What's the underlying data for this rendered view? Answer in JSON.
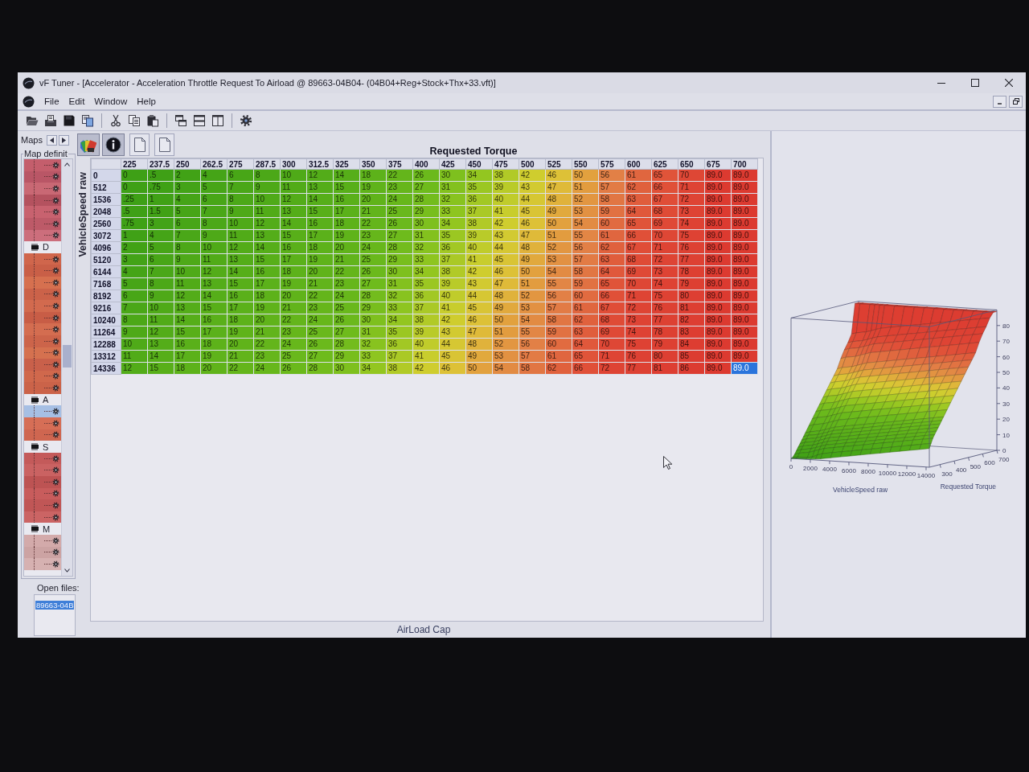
{
  "window": {
    "title": "vF Tuner  - [Accelerator - Acceleration Throttle Request To Airload @ 89663-04B04- (04B04+Reg+Stock+Thx+33.vft)]"
  },
  "menu": [
    "File",
    "Edit",
    "Window",
    "Help"
  ],
  "toolbar": [
    {
      "kind": "open"
    },
    {
      "kind": "import"
    },
    {
      "kind": "save"
    },
    {
      "kind": "compare"
    },
    {
      "kind": "separator"
    },
    {
      "kind": "cut"
    },
    {
      "kind": "copy"
    },
    {
      "kind": "paste"
    },
    {
      "kind": "separator"
    },
    {
      "kind": "cascade"
    },
    {
      "kind": "tile_horizontal"
    },
    {
      "kind": "tile_vertical"
    },
    {
      "kind": "separator"
    },
    {
      "kind": "settings"
    }
  ],
  "sidebar": {
    "tab_label": "Maps",
    "group_label": "Map definit",
    "map_tree": [
      {
        "children": [
          {
            "color": "#c45e6c",
            "selected": false
          },
          {
            "color": "#b95666",
            "selected": false
          },
          {
            "color": "#c96874",
            "selected": false
          },
          {
            "color": "#b4525f",
            "selected": false
          },
          {
            "color": "#c8626f",
            "selected": false
          },
          {
            "color": "#bd5a68",
            "selected": false
          },
          {
            "color": "#cc6e7c",
            "selected": false
          }
        ]
      },
      {
        "label": "D",
        "children": [
          {
            "color": "#d0664c",
            "selected": false
          },
          {
            "color": "#c95f47",
            "selected": false
          },
          {
            "color": "#d6704f",
            "selected": false
          },
          {
            "color": "#cb6249",
            "selected": false
          },
          {
            "color": "#d26a4e",
            "selected": false
          },
          {
            "color": "#c85d46",
            "selected": false
          },
          {
            "color": "#d46d50",
            "selected": false
          },
          {
            "color": "#cc644a",
            "selected": false
          },
          {
            "color": "#d5714f",
            "selected": false
          },
          {
            "color": "#c9604a",
            "selected": false
          },
          {
            "color": "#d0684c",
            "selected": false
          },
          {
            "color": "#cb6349",
            "selected": false
          }
        ]
      },
      {
        "label": "A",
        "children": [
          {
            "selected": true
          },
          {
            "color": "#d66e56",
            "selected": false
          },
          {
            "color": "#cf6650",
            "selected": false
          }
        ]
      },
      {
        "label": "S",
        "children": [
          {
            "color": "#c45a5a",
            "selected": false
          },
          {
            "color": "#ca6262",
            "selected": false
          },
          {
            "color": "#bd5353",
            "selected": false
          },
          {
            "color": "#c85c5c",
            "selected": false
          },
          {
            "color": "#c05656",
            "selected": false
          },
          {
            "color": "#cb6464",
            "selected": false
          }
        ]
      },
      {
        "label": "M",
        "children": [
          {
            "color": "#d3aaaa",
            "selected": false
          },
          {
            "color": "#cca3a3",
            "selected": false
          },
          {
            "color": "#d6b1b1",
            "selected": false
          }
        ]
      }
    ],
    "open_files_label": "Open files:",
    "open_files": [
      {
        "label": "89663-04B",
        "selected": true
      }
    ]
  },
  "map_view": {
    "title": "Requested Torque",
    "row_axis_label": "VehicleSpeed raw",
    "footer_label": "AirLoad Cap",
    "view_buttons": [
      {
        "kind": "palette",
        "pressed": true
      },
      {
        "kind": "info",
        "pressed": true
      },
      {
        "kind": "page",
        "pressed": false
      },
      {
        "kind": "page",
        "pressed": false
      }
    ]
  },
  "table": {
    "columns": [
      "225",
      "237.5",
      "250",
      "262.5",
      "275",
      "287.5",
      "300",
      "312.5",
      "325",
      "350",
      "375",
      "400",
      "425",
      "450",
      "475",
      "500",
      "525",
      "550",
      "575",
      "600",
      "625",
      "650",
      "675",
      "700"
    ],
    "rows": [
      {
        "label": "0",
        "cells": [
          {
            "value": "0",
            "selected": false
          },
          {
            "value": ".5",
            "selected": false
          },
          {
            "value": "2",
            "selected": false
          },
          {
            "value": "4",
            "selected": false
          },
          {
            "value": "6",
            "selected": false
          },
          {
            "value": "8",
            "selected": false
          },
          {
            "value": "10",
            "selected": false
          },
          {
            "value": "12",
            "selected": false
          },
          {
            "value": "14",
            "selected": false
          },
          {
            "value": "18",
            "selected": false
          },
          {
            "value": "22",
            "selected": false
          },
          {
            "value": "26",
            "selected": false
          },
          {
            "value": "30",
            "selected": false
          },
          {
            "value": "34",
            "selected": false
          },
          {
            "value": "38",
            "selected": false
          },
          {
            "value": "42",
            "selected": false
          },
          {
            "value": "46",
            "selected": false
          },
          {
            "value": "50",
            "selected": false
          },
          {
            "value": "56",
            "selected": false
          },
          {
            "value": "61",
            "selected": false
          },
          {
            "value": "65",
            "selected": false
          },
          {
            "value": "70",
            "selected": false
          },
          {
            "value": "89.0",
            "selected": false
          },
          {
            "value": "89.0",
            "selected": false
          }
        ]
      },
      {
        "label": "512",
        "cells": [
          {
            "value": "0",
            "selected": false
          },
          {
            "value": ".75",
            "selected": false
          },
          {
            "value": "3",
            "selected": false
          },
          {
            "value": "5",
            "selected": false
          },
          {
            "value": "7",
            "selected": false
          },
          {
            "value": "9",
            "selected": false
          },
          {
            "value": "11",
            "selected": false
          },
          {
            "value": "13",
            "selected": false
          },
          {
            "value": "15",
            "selected": false
          },
          {
            "value": "19",
            "selected": false
          },
          {
            "value": "23",
            "selected": false
          },
          {
            "value": "27",
            "selected": false
          },
          {
            "value": "31",
            "selected": false
          },
          {
            "value": "35",
            "selected": false
          },
          {
            "value": "39",
            "selected": false
          },
          {
            "value": "43",
            "selected": false
          },
          {
            "value": "47",
            "selected": false
          },
          {
            "value": "51",
            "selected": false
          },
          {
            "value": "57",
            "selected": false
          },
          {
            "value": "62",
            "selected": false
          },
          {
            "value": "66",
            "selected": false
          },
          {
            "value": "71",
            "selected": false
          },
          {
            "value": "89.0",
            "selected": false
          },
          {
            "value": "89.0",
            "selected": false
          }
        ]
      },
      {
        "label": "1536",
        "cells": [
          {
            "value": ".25",
            "selected": false
          },
          {
            "value": "1",
            "selected": false
          },
          {
            "value": "4",
            "selected": false
          },
          {
            "value": "6",
            "selected": false
          },
          {
            "value": "8",
            "selected": false
          },
          {
            "value": "10",
            "selected": false
          },
          {
            "value": "12",
            "selected": false
          },
          {
            "value": "14",
            "selected": false
          },
          {
            "value": "16",
            "selected": false
          },
          {
            "value": "20",
            "selected": false
          },
          {
            "value": "24",
            "selected": false
          },
          {
            "value": "28",
            "selected": false
          },
          {
            "value": "32",
            "selected": false
          },
          {
            "value": "36",
            "selected": false
          },
          {
            "value": "40",
            "selected": false
          },
          {
            "value": "44",
            "selected": false
          },
          {
            "value": "48",
            "selected": false
          },
          {
            "value": "52",
            "selected": false
          },
          {
            "value": "58",
            "selected": false
          },
          {
            "value": "63",
            "selected": false
          },
          {
            "value": "67",
            "selected": false
          },
          {
            "value": "72",
            "selected": false
          },
          {
            "value": "89.0",
            "selected": false
          },
          {
            "value": "89.0",
            "selected": false
          }
        ]
      },
      {
        "label": "2048",
        "cells": [
          {
            "value": ".5",
            "selected": false
          },
          {
            "value": "1.5",
            "selected": false
          },
          {
            "value": "5",
            "selected": false
          },
          {
            "value": "7",
            "selected": false
          },
          {
            "value": "9",
            "selected": false
          },
          {
            "value": "11",
            "selected": false
          },
          {
            "value": "13",
            "selected": false
          },
          {
            "value": "15",
            "selected": false
          },
          {
            "value": "17",
            "selected": false
          },
          {
            "value": "21",
            "selected": false
          },
          {
            "value": "25",
            "selected": false
          },
          {
            "value": "29",
            "selected": false
          },
          {
            "value": "33",
            "selected": false
          },
          {
            "value": "37",
            "selected": false
          },
          {
            "value": "41",
            "selected": false
          },
          {
            "value": "45",
            "selected": false
          },
          {
            "value": "49",
            "selected": false
          },
          {
            "value": "53",
            "selected": false
          },
          {
            "value": "59",
            "selected": false
          },
          {
            "value": "64",
            "selected": false
          },
          {
            "value": "68",
            "selected": false
          },
          {
            "value": "73",
            "selected": false
          },
          {
            "value": "89.0",
            "selected": false
          },
          {
            "value": "89.0",
            "selected": false
          }
        ]
      },
      {
        "label": "2560",
        "cells": [
          {
            "value": ".75",
            "selected": false
          },
          {
            "value": "3",
            "selected": false
          },
          {
            "value": "6",
            "selected": false
          },
          {
            "value": "8",
            "selected": false
          },
          {
            "value": "10",
            "selected": false
          },
          {
            "value": "12",
            "selected": false
          },
          {
            "value": "14",
            "selected": false
          },
          {
            "value": "16",
            "selected": false
          },
          {
            "value": "18",
            "selected": false
          },
          {
            "value": "22",
            "selected": false
          },
          {
            "value": "26",
            "selected": false
          },
          {
            "value": "30",
            "selected": false
          },
          {
            "value": "34",
            "selected": false
          },
          {
            "value": "38",
            "selected": false
          },
          {
            "value": "42",
            "selected": false
          },
          {
            "value": "46",
            "selected": false
          },
          {
            "value": "50",
            "selected": false
          },
          {
            "value": "54",
            "selected": false
          },
          {
            "value": "60",
            "selected": false
          },
          {
            "value": "65",
            "selected": false
          },
          {
            "value": "69",
            "selected": false
          },
          {
            "value": "74",
            "selected": false
          },
          {
            "value": "89.0",
            "selected": false
          },
          {
            "value": "89.0",
            "selected": false
          }
        ]
      },
      {
        "label": "3072",
        "cells": [
          {
            "value": "1",
            "selected": false
          },
          {
            "value": "4",
            "selected": false
          },
          {
            "value": "7",
            "selected": false
          },
          {
            "value": "9",
            "selected": false
          },
          {
            "value": "11",
            "selected": false
          },
          {
            "value": "13",
            "selected": false
          },
          {
            "value": "15",
            "selected": false
          },
          {
            "value": "17",
            "selected": false
          },
          {
            "value": "19",
            "selected": false
          },
          {
            "value": "23",
            "selected": false
          },
          {
            "value": "27",
            "selected": false
          },
          {
            "value": "31",
            "selected": false
          },
          {
            "value": "35",
            "selected": false
          },
          {
            "value": "39",
            "selected": false
          },
          {
            "value": "43",
            "selected": false
          },
          {
            "value": "47",
            "selected": false
          },
          {
            "value": "51",
            "selected": false
          },
          {
            "value": "55",
            "selected": false
          },
          {
            "value": "61",
            "selected": false
          },
          {
            "value": "66",
            "selected": false
          },
          {
            "value": "70",
            "selected": false
          },
          {
            "value": "75",
            "selected": false
          },
          {
            "value": "89.0",
            "selected": false
          },
          {
            "value": "89.0",
            "selected": false
          }
        ]
      },
      {
        "label": "4096",
        "cells": [
          {
            "value": "2",
            "selected": false
          },
          {
            "value": "5",
            "selected": false
          },
          {
            "value": "8",
            "selected": false
          },
          {
            "value": "10",
            "selected": false
          },
          {
            "value": "12",
            "selected": false
          },
          {
            "value": "14",
            "selected": false
          },
          {
            "value": "16",
            "selected": false
          },
          {
            "value": "18",
            "selected": false
          },
          {
            "value": "20",
            "selected": false
          },
          {
            "value": "24",
            "selected": false
          },
          {
            "value": "28",
            "selected": false
          },
          {
            "value": "32",
            "selected": false
          },
          {
            "value": "36",
            "selected": false
          },
          {
            "value": "40",
            "selected": false
          },
          {
            "value": "44",
            "selected": false
          },
          {
            "value": "48",
            "selected": false
          },
          {
            "value": "52",
            "selected": false
          },
          {
            "value": "56",
            "selected": false
          },
          {
            "value": "62",
            "selected": false
          },
          {
            "value": "67",
            "selected": false
          },
          {
            "value": "71",
            "selected": false
          },
          {
            "value": "76",
            "selected": false
          },
          {
            "value": "89.0",
            "selected": false
          },
          {
            "value": "89.0",
            "selected": false
          }
        ]
      },
      {
        "label": "5120",
        "cells": [
          {
            "value": "3",
            "selected": false
          },
          {
            "value": "6",
            "selected": false
          },
          {
            "value": "9",
            "selected": false
          },
          {
            "value": "11",
            "selected": false
          },
          {
            "value": "13",
            "selected": false
          },
          {
            "value": "15",
            "selected": false
          },
          {
            "value": "17",
            "selected": false
          },
          {
            "value": "19",
            "selected": false
          },
          {
            "value": "21",
            "selected": false
          },
          {
            "value": "25",
            "selected": false
          },
          {
            "value": "29",
            "selected": false
          },
          {
            "value": "33",
            "selected": false
          },
          {
            "value": "37",
            "selected": false
          },
          {
            "value": "41",
            "selected": false
          },
          {
            "value": "45",
            "selected": false
          },
          {
            "value": "49",
            "selected": false
          },
          {
            "value": "53",
            "selected": false
          },
          {
            "value": "57",
            "selected": false
          },
          {
            "value": "63",
            "selected": false
          },
          {
            "value": "68",
            "selected": false
          },
          {
            "value": "72",
            "selected": false
          },
          {
            "value": "77",
            "selected": false
          },
          {
            "value": "89.0",
            "selected": false
          },
          {
            "value": "89.0",
            "selected": false
          }
        ]
      },
      {
        "label": "6144",
        "cells": [
          {
            "value": "4",
            "selected": false
          },
          {
            "value": "7",
            "selected": false
          },
          {
            "value": "10",
            "selected": false
          },
          {
            "value": "12",
            "selected": false
          },
          {
            "value": "14",
            "selected": false
          },
          {
            "value": "16",
            "selected": false
          },
          {
            "value": "18",
            "selected": false
          },
          {
            "value": "20",
            "selected": false
          },
          {
            "value": "22",
            "selected": false
          },
          {
            "value": "26",
            "selected": false
          },
          {
            "value": "30",
            "selected": false
          },
          {
            "value": "34",
            "selected": false
          },
          {
            "value": "38",
            "selected": false
          },
          {
            "value": "42",
            "selected": false
          },
          {
            "value": "46",
            "selected": false
          },
          {
            "value": "50",
            "selected": false
          },
          {
            "value": "54",
            "selected": false
          },
          {
            "value": "58",
            "selected": false
          },
          {
            "value": "64",
            "selected": false
          },
          {
            "value": "69",
            "selected": false
          },
          {
            "value": "73",
            "selected": false
          },
          {
            "value": "78",
            "selected": false
          },
          {
            "value": "89.0",
            "selected": false
          },
          {
            "value": "89.0",
            "selected": false
          }
        ]
      },
      {
        "label": "7168",
        "cells": [
          {
            "value": "5",
            "selected": false
          },
          {
            "value": "8",
            "selected": false
          },
          {
            "value": "11",
            "selected": false
          },
          {
            "value": "13",
            "selected": false
          },
          {
            "value": "15",
            "selected": false
          },
          {
            "value": "17",
            "selected": false
          },
          {
            "value": "19",
            "selected": false
          },
          {
            "value": "21",
            "selected": false
          },
          {
            "value": "23",
            "selected": false
          },
          {
            "value": "27",
            "selected": false
          },
          {
            "value": "31",
            "selected": false
          },
          {
            "value": "35",
            "selected": false
          },
          {
            "value": "39",
            "selected": false
          },
          {
            "value": "43",
            "selected": false
          },
          {
            "value": "47",
            "selected": false
          },
          {
            "value": "51",
            "selected": false
          },
          {
            "value": "55",
            "selected": false
          },
          {
            "value": "59",
            "selected": false
          },
          {
            "value": "65",
            "selected": false
          },
          {
            "value": "70",
            "selected": false
          },
          {
            "value": "74",
            "selected": false
          },
          {
            "value": "79",
            "selected": false
          },
          {
            "value": "89.0",
            "selected": false
          },
          {
            "value": "89.0",
            "selected": false
          }
        ]
      },
      {
        "label": "8192",
        "cells": [
          {
            "value": "6",
            "selected": false
          },
          {
            "value": "9",
            "selected": false
          },
          {
            "value": "12",
            "selected": false
          },
          {
            "value": "14",
            "selected": false
          },
          {
            "value": "16",
            "selected": false
          },
          {
            "value": "18",
            "selected": false
          },
          {
            "value": "20",
            "selected": false
          },
          {
            "value": "22",
            "selected": false
          },
          {
            "value": "24",
            "selected": false
          },
          {
            "value": "28",
            "selected": false
          },
          {
            "value": "32",
            "selected": false
          },
          {
            "value": "36",
            "selected": false
          },
          {
            "value": "40",
            "selected": false
          },
          {
            "value": "44",
            "selected": false
          },
          {
            "value": "48",
            "selected": false
          },
          {
            "value": "52",
            "selected": false
          },
          {
            "value": "56",
            "selected": false
          },
          {
            "value": "60",
            "selected": false
          },
          {
            "value": "66",
            "selected": false
          },
          {
            "value": "71",
            "selected": false
          },
          {
            "value": "75",
            "selected": false
          },
          {
            "value": "80",
            "selected": false
          },
          {
            "value": "89.0",
            "selected": false
          },
          {
            "value": "89.0",
            "selected": false
          }
        ]
      },
      {
        "label": "9216",
        "cells": [
          {
            "value": "7",
            "selected": false
          },
          {
            "value": "10",
            "selected": false
          },
          {
            "value": "13",
            "selected": false
          },
          {
            "value": "15",
            "selected": false
          },
          {
            "value": "17",
            "selected": false
          },
          {
            "value": "19",
            "selected": false
          },
          {
            "value": "21",
            "selected": false
          },
          {
            "value": "23",
            "selected": false
          },
          {
            "value": "25",
            "selected": false
          },
          {
            "value": "29",
            "selected": false
          },
          {
            "value": "33",
            "selected": false
          },
          {
            "value": "37",
            "selected": false
          },
          {
            "value": "41",
            "selected": false
          },
          {
            "value": "45",
            "selected": false
          },
          {
            "value": "49",
            "selected": false
          },
          {
            "value": "53",
            "selected": false
          },
          {
            "value": "57",
            "selected": false
          },
          {
            "value": "61",
            "selected": false
          },
          {
            "value": "67",
            "selected": false
          },
          {
            "value": "72",
            "selected": false
          },
          {
            "value": "76",
            "selected": false
          },
          {
            "value": "81",
            "selected": false
          },
          {
            "value": "89.0",
            "selected": false
          },
          {
            "value": "89.0",
            "selected": false
          }
        ]
      },
      {
        "label": "10240",
        "cells": [
          {
            "value": "8",
            "selected": false
          },
          {
            "value": "11",
            "selected": false
          },
          {
            "value": "14",
            "selected": false
          },
          {
            "value": "16",
            "selected": false
          },
          {
            "value": "18",
            "selected": false
          },
          {
            "value": "20",
            "selected": false
          },
          {
            "value": "22",
            "selected": false
          },
          {
            "value": "24",
            "selected": false
          },
          {
            "value": "26",
            "selected": false
          },
          {
            "value": "30",
            "selected": false
          },
          {
            "value": "34",
            "selected": false
          },
          {
            "value": "38",
            "selected": false
          },
          {
            "value": "42",
            "selected": false
          },
          {
            "value": "46",
            "selected": false
          },
          {
            "value": "50",
            "selected": false
          },
          {
            "value": "54",
            "selected": false
          },
          {
            "value": "58",
            "selected": false
          },
          {
            "value": "62",
            "selected": false
          },
          {
            "value": "68",
            "selected": false
          },
          {
            "value": "73",
            "selected": false
          },
          {
            "value": "77",
            "selected": false
          },
          {
            "value": "82",
            "selected": false
          },
          {
            "value": "89.0",
            "selected": false
          },
          {
            "value": "89.0",
            "selected": false
          }
        ]
      },
      {
        "label": "11264",
        "cells": [
          {
            "value": "9",
            "selected": false
          },
          {
            "value": "12",
            "selected": false
          },
          {
            "value": "15",
            "selected": false
          },
          {
            "value": "17",
            "selected": false
          },
          {
            "value": "19",
            "selected": false
          },
          {
            "value": "21",
            "selected": false
          },
          {
            "value": "23",
            "selected": false
          },
          {
            "value": "25",
            "selected": false
          },
          {
            "value": "27",
            "selected": false
          },
          {
            "value": "31",
            "selected": false
          },
          {
            "value": "35",
            "selected": false
          },
          {
            "value": "39",
            "selected": false
          },
          {
            "value": "43",
            "selected": false
          },
          {
            "value": "47",
            "selected": false
          },
          {
            "value": "51",
            "selected": false
          },
          {
            "value": "55",
            "selected": false
          },
          {
            "value": "59",
            "selected": false
          },
          {
            "value": "63",
            "selected": false
          },
          {
            "value": "69",
            "selected": false
          },
          {
            "value": "74",
            "selected": false
          },
          {
            "value": "78",
            "selected": false
          },
          {
            "value": "83",
            "selected": false
          },
          {
            "value": "89.0",
            "selected": false
          },
          {
            "value": "89.0",
            "selected": false
          }
        ]
      },
      {
        "label": "12288",
        "cells": [
          {
            "value": "10",
            "selected": false
          },
          {
            "value": "13",
            "selected": false
          },
          {
            "value": "16",
            "selected": false
          },
          {
            "value": "18",
            "selected": false
          },
          {
            "value": "20",
            "selected": false
          },
          {
            "value": "22",
            "selected": false
          },
          {
            "value": "24",
            "selected": false
          },
          {
            "value": "26",
            "selected": false
          },
          {
            "value": "28",
            "selected": false
          },
          {
            "value": "32",
            "selected": false
          },
          {
            "value": "36",
            "selected": false
          },
          {
            "value": "40",
            "selected": false
          },
          {
            "value": "44",
            "selected": false
          },
          {
            "value": "48",
            "selected": false
          },
          {
            "value": "52",
            "selected": false
          },
          {
            "value": "56",
            "selected": false
          },
          {
            "value": "60",
            "selected": false
          },
          {
            "value": "64",
            "selected": false
          },
          {
            "value": "70",
            "selected": false
          },
          {
            "value": "75",
            "selected": false
          },
          {
            "value": "79",
            "selected": false
          },
          {
            "value": "84",
            "selected": false
          },
          {
            "value": "89.0",
            "selected": false
          },
          {
            "value": "89.0",
            "selected": false
          }
        ]
      },
      {
        "label": "13312",
        "cells": [
          {
            "value": "11",
            "selected": false
          },
          {
            "value": "14",
            "selected": false
          },
          {
            "value": "17",
            "selected": false
          },
          {
            "value": "19",
            "selected": false
          },
          {
            "value": "21",
            "selected": false
          },
          {
            "value": "23",
            "selected": false
          },
          {
            "value": "25",
            "selected": false
          },
          {
            "value": "27",
            "selected": false
          },
          {
            "value": "29",
            "selected": false
          },
          {
            "value": "33",
            "selected": false
          },
          {
            "value": "37",
            "selected": false
          },
          {
            "value": "41",
            "selected": false
          },
          {
            "value": "45",
            "selected": false
          },
          {
            "value": "49",
            "selected": false
          },
          {
            "value": "53",
            "selected": false
          },
          {
            "value": "57",
            "selected": false
          },
          {
            "value": "61",
            "selected": false
          },
          {
            "value": "65",
            "selected": false
          },
          {
            "value": "71",
            "selected": false
          },
          {
            "value": "76",
            "selected": false
          },
          {
            "value": "80",
            "selected": false
          },
          {
            "value": "85",
            "selected": false
          },
          {
            "value": "89.0",
            "selected": false
          },
          {
            "value": "89.0",
            "selected": false
          }
        ]
      },
      {
        "label": "14336",
        "cells": [
          {
            "value": "12",
            "selected": false
          },
          {
            "value": "15",
            "selected": false
          },
          {
            "value": "18",
            "selected": false
          },
          {
            "value": "20",
            "selected": false
          },
          {
            "value": "22",
            "selected": false
          },
          {
            "value": "24",
            "selected": false
          },
          {
            "value": "26",
            "selected": false
          },
          {
            "value": "28",
            "selected": false
          },
          {
            "value": "30",
            "selected": false
          },
          {
            "value": "34",
            "selected": false
          },
          {
            "value": "38",
            "selected": false
          },
          {
            "value": "42",
            "selected": false
          },
          {
            "value": "46",
            "selected": false
          },
          {
            "value": "50",
            "selected": false
          },
          {
            "value": "54",
            "selected": false
          },
          {
            "value": "58",
            "selected": false
          },
          {
            "value": "62",
            "selected": false
          },
          {
            "value": "66",
            "selected": false
          },
          {
            "value": "72",
            "selected": false
          },
          {
            "value": "77",
            "selected": false
          },
          {
            "value": "81",
            "selected": false
          },
          {
            "value": "86",
            "selected": false
          },
          {
            "value": "89.0",
            "selected": false
          },
          {
            "value": "89.0",
            "selected": true
          }
        ]
      }
    ]
  },
  "surface_chart": {
    "x_axis_title": "VehicleSpeed raw",
    "y_axis_title": "Requested Torque",
    "x_ticks": [
      "0",
      "2000",
      "4000",
      "6000",
      "8000",
      "10000",
      "12000",
      "14000"
    ],
    "y_ticks": [
      "300",
      "400",
      "500",
      "600",
      "700"
    ],
    "z_ticks": [
      "80",
      "70",
      "60",
      "50",
      "40",
      "30",
      "20",
      "10",
      "0"
    ]
  }
}
